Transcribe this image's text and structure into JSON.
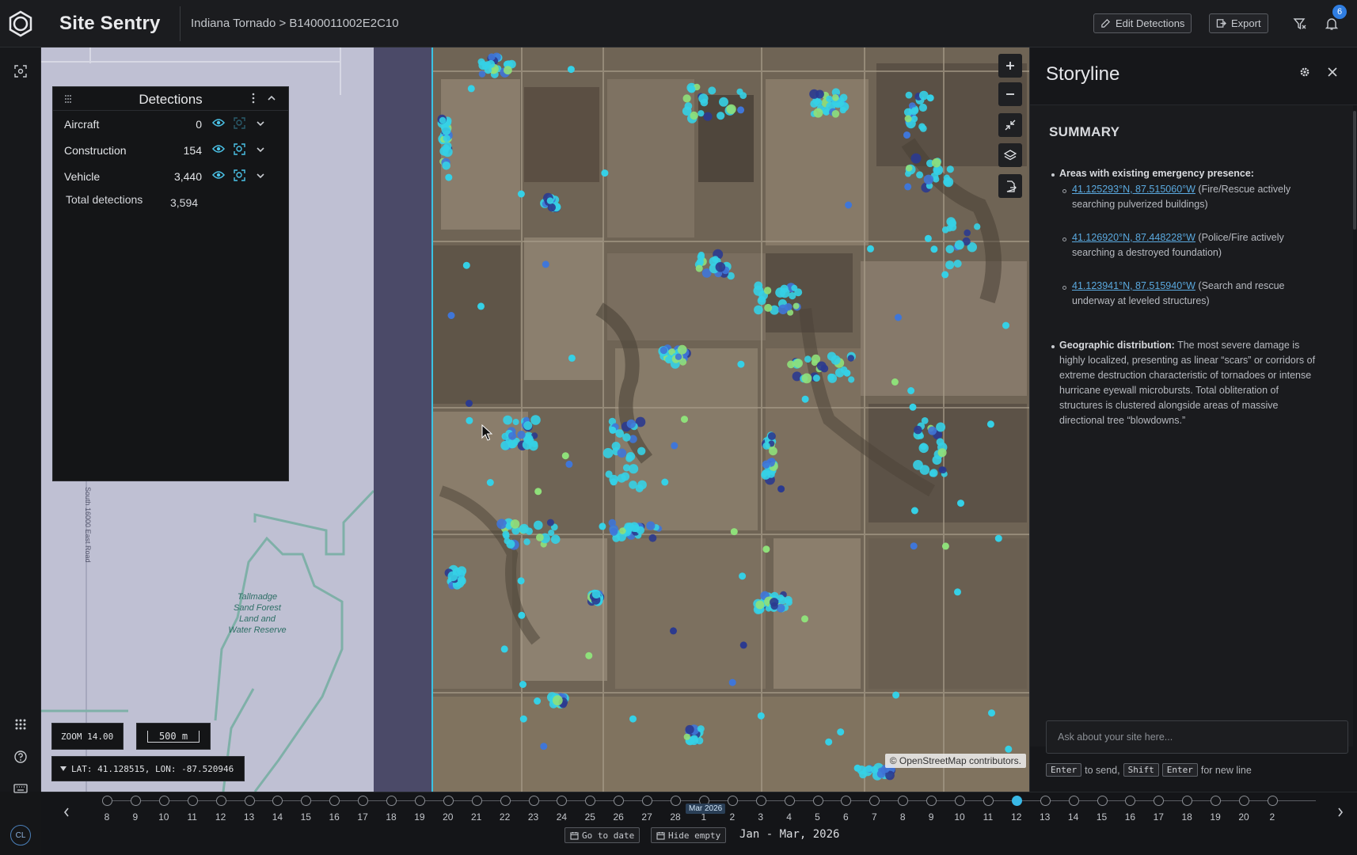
{
  "header": {
    "app_title": "Site Sentry",
    "breadcrumb": "Indiana Tornado > B1400011002E2C10",
    "edit_label": "Edit Detections",
    "export_label": "Export",
    "notification_count": "6"
  },
  "rail": {
    "icons": [
      "scan-icon",
      "apps-grid-icon",
      "help-icon",
      "keyboard-icon"
    ],
    "avatar_initials": "CL"
  },
  "detections": {
    "title": "Detections",
    "rows": [
      {
        "label": "Aircraft",
        "count": "0"
      },
      {
        "label": "Construction",
        "count": "154"
      },
      {
        "label": "Vehicle",
        "count": "3,440"
      }
    ],
    "total_label": "Total detections",
    "total_value": "3,594"
  },
  "map": {
    "zoom": "ZOOM 14.00",
    "scale": "500 m",
    "coords": "LAT: 41.128515, LON: -87.520946",
    "attribution": "© OpenStreetMap contributors.",
    "road_label": "South 16000 East Road",
    "reserve_label": "Tallmadge Sand Forest Land and Water Reserve",
    "colors": {
      "cyan": "#35d0e6",
      "green": "#8fe07a",
      "navy": "#2b3a8f",
      "blue": "#3f76d8"
    }
  },
  "storyline": {
    "title": "Storyline",
    "summary_heading": "SUMMARY",
    "presence_label": "Areas with existing emergency presence:",
    "locations": [
      {
        "coord": "41.125293°N, 87.515060°W",
        "note": " (Fire/Rescue actively searching pulverized buildings)"
      },
      {
        "coord": "41.126920°N, 87.448228°W",
        "note": " (Police/Fire actively searching a destroyed foundation)"
      },
      {
        "coord": "41.123941°N, 87.515940°W",
        "note": " (Search and rescue underway at leveled structures)"
      }
    ],
    "geo_label": "Geographic distribution:",
    "geo_text": " The most severe damage is highly localized, presenting as linear “scars” or corridors of extreme destruction characteristic of tornadoes or intense hurricane eyewall microbursts. Total obliteration of structures is clustered alongside areas of massive directional tree “blowdowns.”",
    "ask_placeholder": "Ask about your site here...",
    "hint_enter": "Enter",
    "hint_send": "to send,",
    "hint_shift": "Shift",
    "hint_enter2": "Enter",
    "hint_newline": "for new line"
  },
  "timeline": {
    "days": [
      "8",
      "9",
      "10",
      "11",
      "12",
      "13",
      "14",
      "15",
      "16",
      "17",
      "18",
      "19",
      "20",
      "21",
      "22",
      "23",
      "24",
      "25",
      "26",
      "27",
      "28",
      "1",
      "2",
      "3",
      "4",
      "5",
      "6",
      "7",
      "8",
      "9",
      "10",
      "11",
      "12",
      "13",
      "14",
      "15",
      "16",
      "17",
      "18",
      "19",
      "20",
      "2"
    ],
    "active_index": 32,
    "month_marker": "Mar 2026",
    "go_to_date": "Go to date",
    "hide_empty": "Hide empty",
    "range": "Jan - Mar, 2026"
  }
}
